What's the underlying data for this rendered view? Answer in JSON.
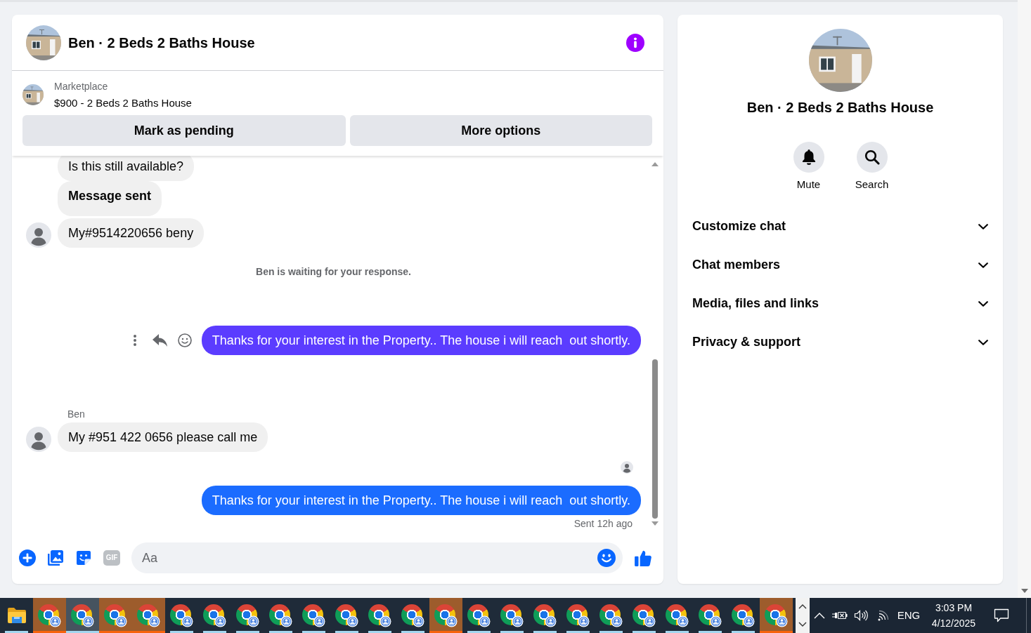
{
  "conversation": {
    "title": "Ben · 2 Beds 2 Baths House",
    "listing": {
      "source": "Marketplace",
      "title": "$900 - 2 Beds 2 Baths House"
    },
    "actions": [
      "Mark as pending",
      "More options"
    ],
    "messages": [
      {
        "kind": "incoming",
        "text": "Is this still available?",
        "bold": false,
        "avatar": false
      },
      {
        "kind": "incoming",
        "text": "Message sent",
        "bold": true,
        "avatar": false
      },
      {
        "kind": "incoming",
        "text": "My#9514220656 beny",
        "bold": false,
        "avatar": true
      },
      {
        "kind": "notice",
        "text": "Ben is waiting for your response."
      },
      {
        "kind": "outgoing",
        "text": "Thanks for your interest in the Property.. The house i will reach  out shortly.",
        "color": "#5b3cff",
        "hovered": true,
        "seen": false
      },
      {
        "kind": "incoming",
        "sender": "Ben",
        "text": "My #951 422 0656 please call me",
        "bold": false,
        "avatar": true
      },
      {
        "kind": "outgoing",
        "text": "Thanks for your interest in the Property.. The house i will reach  out shortly.",
        "color": "#1b6cff",
        "hovered": false,
        "seen": true,
        "status": "Sent 12h ago"
      }
    ],
    "composer": {
      "gif_label": "GIF",
      "placeholder": "Aa"
    }
  },
  "details": {
    "title": "Ben · 2 Beds 2 Baths House",
    "actions": [
      {
        "kind": "mute",
        "label": "Mute"
      },
      {
        "kind": "search",
        "label": "Search"
      }
    ],
    "sections": [
      {
        "label": "Customize chat",
        "expanded": false
      },
      {
        "label": "Chat members",
        "expanded": false
      },
      {
        "label": "Media, files and links",
        "expanded": false
      },
      {
        "label": "Privacy & support",
        "expanded": false
      }
    ]
  },
  "taskbar": {
    "apps": [
      {
        "kind": "file_explorer",
        "selected": false,
        "flashing": false
      },
      {
        "kind": "browser",
        "selected": false,
        "flashing": true
      },
      {
        "kind": "browser",
        "selected": true,
        "flashing": false
      },
      {
        "kind": "browser",
        "selected": false,
        "flashing": true
      },
      {
        "kind": "browser",
        "selected": false,
        "flashing": true
      },
      {
        "kind": "browser",
        "selected": false,
        "flashing": false
      },
      {
        "kind": "browser",
        "selected": false,
        "flashing": false
      },
      {
        "kind": "browser",
        "selected": false,
        "flashing": false
      },
      {
        "kind": "browser",
        "selected": false,
        "flashing": false
      },
      {
        "kind": "browser",
        "selected": false,
        "flashing": false
      },
      {
        "kind": "browser",
        "selected": false,
        "flashing": false
      },
      {
        "kind": "browser",
        "selected": false,
        "flashing": false
      },
      {
        "kind": "browser",
        "selected": false,
        "flashing": false
      },
      {
        "kind": "browser",
        "selected": false,
        "flashing": true
      },
      {
        "kind": "browser",
        "selected": false,
        "flashing": false
      },
      {
        "kind": "browser",
        "selected": false,
        "flashing": false
      },
      {
        "kind": "browser",
        "selected": false,
        "flashing": false
      },
      {
        "kind": "browser",
        "selected": false,
        "flashing": false
      },
      {
        "kind": "browser",
        "selected": false,
        "flashing": false
      },
      {
        "kind": "browser",
        "selected": false,
        "flashing": false
      },
      {
        "kind": "browser",
        "selected": false,
        "flashing": false
      },
      {
        "kind": "browser",
        "selected": false,
        "flashing": false
      },
      {
        "kind": "browser",
        "selected": false,
        "flashing": false
      },
      {
        "kind": "browser",
        "selected": false,
        "flashing": true
      }
    ],
    "tray": {
      "language": "ENG",
      "time": "3:03 PM",
      "date": "4/12/2025"
    }
  }
}
